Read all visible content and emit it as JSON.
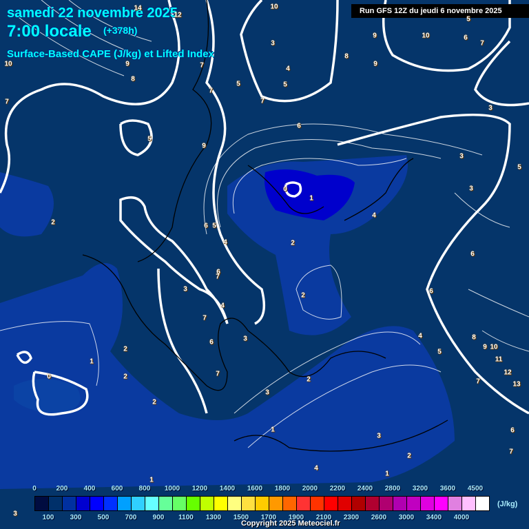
{
  "header": {
    "date": "samedi 22 novembre 2025",
    "time": "7:00 locale",
    "lead": "(+378h)",
    "parameter": "Surface-Based CAPE (J/kg) et Lifted Index",
    "run": "Run GFS 12Z du jeudi 6 novembre 2025"
  },
  "contour_labels": [
    "14",
    "12",
    "10",
    "10",
    "9",
    "6",
    "7",
    "5",
    "10",
    "9",
    "8",
    "7",
    "7",
    "5",
    "4",
    "5",
    "3",
    "8",
    "9",
    "7",
    "7",
    "6",
    "5",
    "9",
    "3",
    "3",
    "5",
    "3",
    "0",
    "1",
    "2",
    "6",
    "5",
    "4",
    "2",
    "4",
    "6",
    "6",
    "7",
    "3",
    "2",
    "6",
    "4",
    "7",
    "6",
    "3",
    "4",
    "8",
    "9",
    "10",
    "11",
    "5",
    "12",
    "13",
    "7",
    "1",
    "2",
    "2",
    "0",
    "7",
    "2",
    "3",
    "2",
    "1",
    "3",
    "2",
    "6",
    "7",
    "4",
    "1",
    "1",
    "3"
  ],
  "legend": {
    "unit": "(J/kg)",
    "top_ticks": [
      "0",
      "200",
      "400",
      "600",
      "800",
      "1000",
      "1200",
      "1400",
      "1600",
      "1800",
      "2000",
      "2200",
      "2400",
      "2800",
      "3200",
      "3600",
      "4500"
    ],
    "bottom_ticks": [
      "100",
      "300",
      "500",
      "700",
      "900",
      "1100",
      "1300",
      "1500",
      "1700",
      "1900",
      "2100",
      "2300",
      "2600",
      "3000",
      "3400",
      "4000"
    ],
    "colors": [
      "#000c40",
      "#00306a",
      "#0030a0",
      "#0000d0",
      "#0000ff",
      "#0030ff",
      "#00a0ff",
      "#30d0ff",
      "#66ffff",
      "#66ff99",
      "#66ff66",
      "#66ff00",
      "#c0ff00",
      "#ffff00",
      "#ffff80",
      "#ffe040",
      "#ffcc00",
      "#ff9900",
      "#ff6600",
      "#ff3333",
      "#ff3300",
      "#ff0000",
      "#e00000",
      "#b00000",
      "#b00030",
      "#b00070",
      "#b000b0",
      "#c000c0",
      "#e000e0",
      "#ff00ff",
      "#e080e0",
      "#ffc0ff",
      "#ffffff"
    ]
  },
  "copyright": "Copyright 2025 Meteociel.fr"
}
